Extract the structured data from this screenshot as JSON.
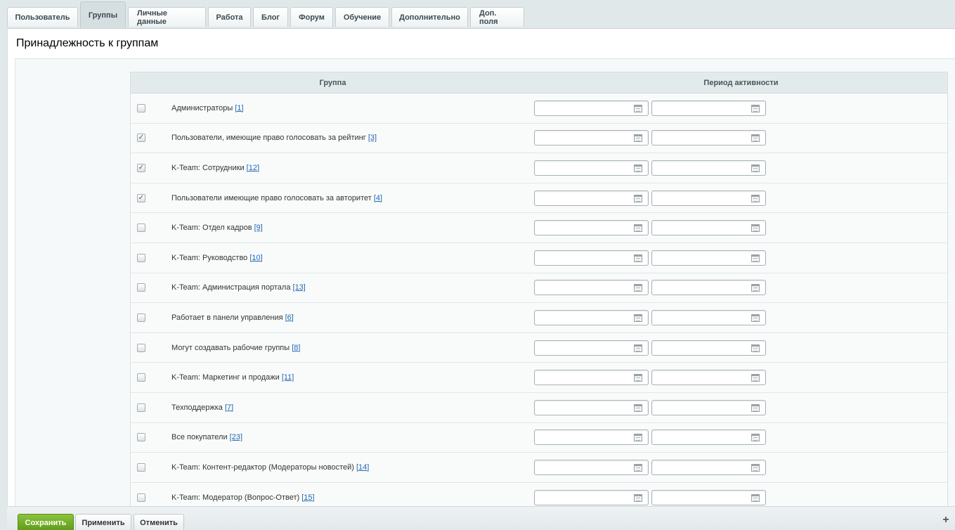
{
  "tabs": [
    {
      "label": "Пользователь",
      "active": false
    },
    {
      "label": "Группы",
      "active": true
    },
    {
      "label": "Личные данные",
      "active": false
    },
    {
      "label": "Работа",
      "active": false
    },
    {
      "label": "Блог",
      "active": false
    },
    {
      "label": "Форум",
      "active": false
    },
    {
      "label": "Обучение",
      "active": false
    },
    {
      "label": "Дополнительно",
      "active": false
    },
    {
      "label": "Доп. поля",
      "active": false
    }
  ],
  "section_title": "Принадлежность к группам",
  "table": {
    "col_group": "Группа",
    "col_period": "Период активности",
    "rows": [
      {
        "name": "Администраторы",
        "id": "[1]",
        "checked": false
      },
      {
        "name": "Пользователи, имеющие право голосовать за рейтинг",
        "id": "[3]",
        "checked": true
      },
      {
        "name": "K-Team: Сотрудники",
        "id": "[12]",
        "checked": true
      },
      {
        "name": "Пользователи имеющие право голосовать за авторитет",
        "id": "[4]",
        "checked": true
      },
      {
        "name": "K-Team: Отдел кадров",
        "id": "[9]",
        "checked": false
      },
      {
        "name": "K-Team: Руководство",
        "id": "[10]",
        "checked": false
      },
      {
        "name": "K-Team: Администрация портала",
        "id": "[13]",
        "checked": false
      },
      {
        "name": "Работает в панели управления",
        "id": "[6]",
        "checked": false
      },
      {
        "name": "Могут создавать рабочие группы",
        "id": "[8]",
        "checked": false
      },
      {
        "name": "K-Team: Маркетинг и продажи",
        "id": "[11]",
        "checked": false
      },
      {
        "name": "Техподдержка",
        "id": "[7]",
        "checked": false
      },
      {
        "name": "Все покупатели",
        "id": "[23]",
        "checked": false
      },
      {
        "name": "K-Team: Контент-редактор (Модераторы новостей)",
        "id": "[14]",
        "checked": false
      },
      {
        "name": "K-Team: Модератор (Вопрос-Ответ)",
        "id": "[15]",
        "checked": false
      }
    ]
  },
  "footer": {
    "save_label": "Сохранить",
    "apply_label": "Применить",
    "cancel_label": "Отменить",
    "plus_symbol": "+"
  },
  "colors": {
    "save_button": "#6fac22",
    "link": "#2067b0"
  }
}
